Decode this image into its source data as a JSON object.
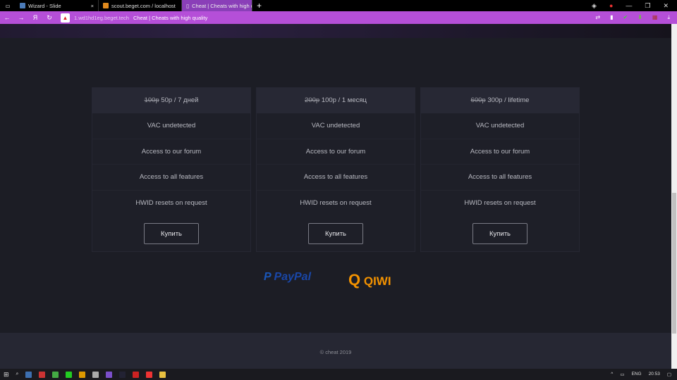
{
  "browser": {
    "tabs": [
      {
        "title": "Wizard - Slide"
      },
      {
        "title": "scout.beget.com / localhost"
      },
      {
        "title": "Cheat | Cheats with high quality",
        "active": true
      }
    ],
    "url": "1.wd1hd1eg.beget.tech",
    "page_title": "Cheat | Cheats with high quality",
    "accent": "#b54fd8"
  },
  "plans": [
    {
      "old_price": "100р",
      "price": "50р / 7 дней",
      "features": [
        "VAC undetected",
        "Access to our forum",
        "Access to all features",
        "HWID resets on request"
      ],
      "button": "Купить"
    },
    {
      "old_price": "200р",
      "price": "100р / 1 месяц",
      "features": [
        "VAC undetected",
        "Access to our forum",
        "Access to all features",
        "HWID resets on request"
      ],
      "button": "Купить"
    },
    {
      "old_price": "600р",
      "price": "300р / lifetime",
      "features": [
        "VAC undetected",
        "Access to our forum",
        "Access to all features",
        "HWID resets on request"
      ],
      "button": "Купить"
    }
  ],
  "payments": {
    "paypal": "PayPal",
    "qiwi": "QIWI"
  },
  "footer": "© cheat 2019",
  "taskbar": {
    "lang": "ENG",
    "time": "20:53"
  }
}
